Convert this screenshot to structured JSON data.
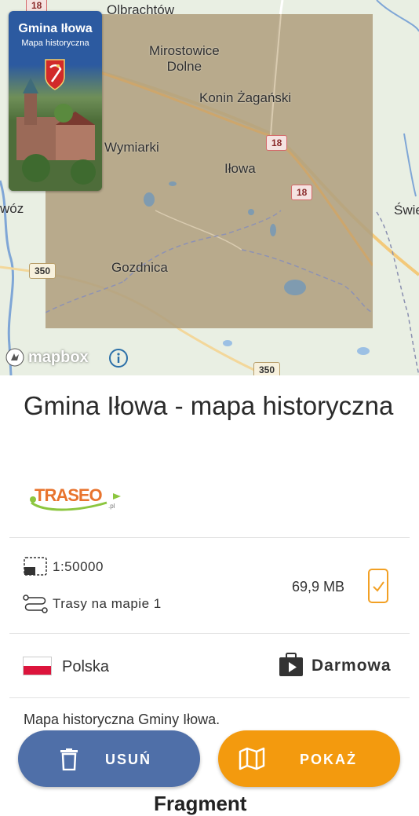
{
  "map": {
    "places": {
      "olbrachtow": "Olbrachtów",
      "mirostowice": "Mirostowice\nDolne",
      "konin": "Konin Żagański",
      "wymiarki": "Wymiarki",
      "ilowa": "Iłowa",
      "gozdnica": "Gozdnica",
      "wow": "wóz",
      "swie": "Świe"
    },
    "roads": {
      "r18_top": "18",
      "r18_a": "18",
      "r18_b": "18",
      "r350_a": "350",
      "r350_b": "350"
    },
    "thumbnail": {
      "title": "Gmina Iłowa",
      "subtitle": "Mapa historyczna"
    },
    "attribution": "mapbox"
  },
  "details": {
    "title": "Gmina Iłowa - mapa historyczna",
    "publisher": "TRASEO",
    "publisher_suffix": ".pl",
    "scale": "1:50000",
    "routes": "Trasy na mapie 1",
    "size": "69,9 MB",
    "country": "Polska",
    "price": "Darmowa",
    "description": "Mapa historyczna Gminy Iłowa.",
    "next_section": "Fragment"
  },
  "buttons": {
    "delete": "USUŃ",
    "show": "POKAŻ"
  },
  "colors": {
    "delete_button": "#4f6fa8",
    "show_button": "#f39a0e",
    "overlay": "#b0a07f",
    "downloaded_icon": "#f2a024"
  }
}
